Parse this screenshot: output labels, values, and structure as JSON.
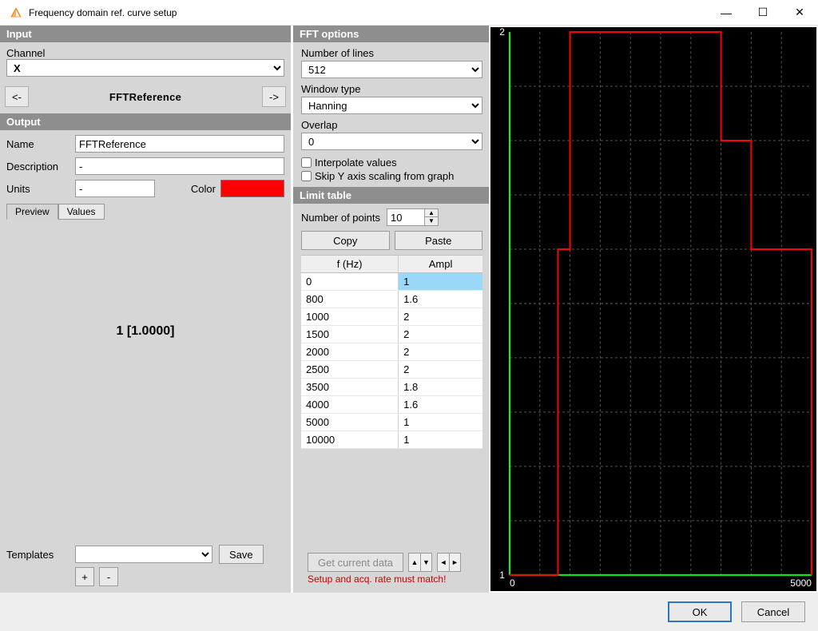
{
  "window": {
    "title": "Frequency domain ref. curve setup",
    "minimize_glyph": "—",
    "maximize_glyph": "☐",
    "close_glyph": "✕"
  },
  "input": {
    "header": "Input",
    "channel_label": "Channel",
    "channel_value": "X",
    "prev_glyph": "<-",
    "next_glyph": "->",
    "nav_title": "FFTReference"
  },
  "output": {
    "header": "Output",
    "name_label": "Name",
    "name_value": "FFTReference",
    "desc_label": "Description",
    "desc_value": "-",
    "units_label": "Units",
    "units_value": "-",
    "color_label": "Color",
    "color_value": "#ff0000",
    "tab_preview": "Preview",
    "tab_values": "Values",
    "preview_text": "1 [1.0000]",
    "templates_label": "Templates",
    "templates_value": "",
    "save_label": "Save",
    "add_glyph": "+",
    "remove_glyph": "-"
  },
  "fft": {
    "header": "FFT options",
    "lines_label": "Number of lines",
    "lines_value": "512",
    "window_label": "Window type",
    "window_value": "Hanning",
    "overlap_label": "Overlap",
    "overlap_value": "0",
    "interpolate_label": "Interpolate values",
    "skipy_label": "Skip Y axis scaling from graph"
  },
  "limit": {
    "header": "Limit table",
    "np_label": "Number of points",
    "np_value": "10",
    "copy_label": "Copy",
    "paste_label": "Paste",
    "col_f": "f (Hz)",
    "col_a": "Ampl",
    "get_label": "Get current data",
    "warn_text": "Setup and acq. rate must match!",
    "rows": [
      {
        "f": "0",
        "a": "1"
      },
      {
        "f": "800",
        "a": "1.6"
      },
      {
        "f": "1000",
        "a": "2"
      },
      {
        "f": "1500",
        "a": "2"
      },
      {
        "f": "2000",
        "a": "2"
      },
      {
        "f": "2500",
        "a": "2"
      },
      {
        "f": "3500",
        "a": "1.8"
      },
      {
        "f": "4000",
        "a": "1.6"
      },
      {
        "f": "5000",
        "a": "1"
      },
      {
        "f": "10000",
        "a": "1"
      }
    ]
  },
  "chart_data": {
    "type": "line",
    "x": [
      0,
      800,
      1000,
      1500,
      2000,
      2500,
      3500,
      4000,
      5000,
      10000
    ],
    "values": [
      1,
      1.6,
      2,
      2,
      2,
      2,
      1.8,
      1.6,
      1,
      1
    ],
    "xlim": [
      0,
      5000
    ],
    "ylim": [
      1,
      2
    ],
    "xlabel": "",
    "ylabel": "",
    "title": "",
    "xticks": [
      0,
      5000
    ],
    "yticks": [
      1,
      2
    ],
    "line_color": "#ff0000",
    "axis_color": "#00ff00",
    "bg": "#000000",
    "step": true
  },
  "dialog": {
    "ok": "OK",
    "cancel": "Cancel"
  }
}
